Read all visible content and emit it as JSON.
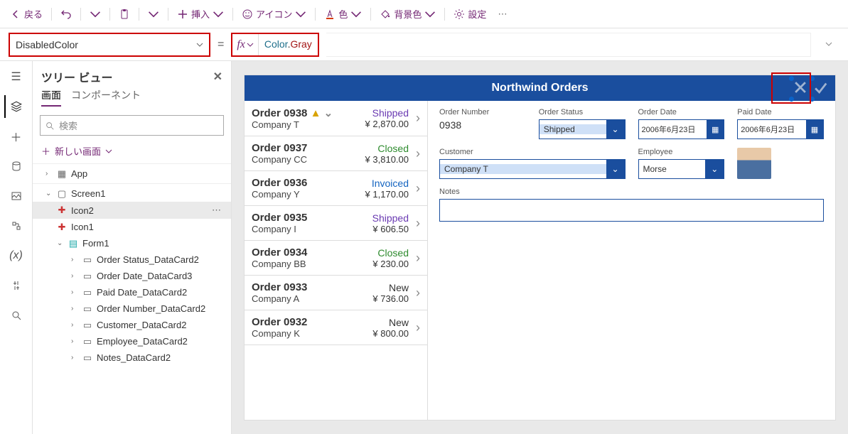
{
  "toolbar": {
    "back": "戻る",
    "insert": "挿入",
    "icon": "アイコン",
    "color": "色",
    "bg": "背景色",
    "settings": "設定"
  },
  "property": {
    "name": "DisabledColor"
  },
  "formula": {
    "part1": "Color",
    "part2": ".",
    "part3": "Gray"
  },
  "tree": {
    "title": "ツリー ビュー",
    "tab_screen": "画面",
    "tab_comp": "コンポーネント",
    "search_ph": "検索",
    "new_screen": "新しい画面",
    "nodes": {
      "app": "App",
      "screen1": "Screen1",
      "icon2": "Icon2",
      "icon1": "Icon1",
      "form1": "Form1",
      "dc_status": "Order Status_DataCard2",
      "dc_orderdate": "Order Date_DataCard3",
      "dc_paid": "Paid Date_DataCard2",
      "dc_num": "Order Number_DataCard2",
      "dc_cust": "Customer_DataCard2",
      "dc_emp": "Employee_DataCard2",
      "dc_notes": "Notes_DataCard2"
    }
  },
  "app": {
    "title": "Northwind Orders",
    "orders": [
      {
        "title": "Order 0938",
        "company": "Company T",
        "status": "Shipped",
        "price": "¥ 2,870.00",
        "warn": true
      },
      {
        "title": "Order 0937",
        "company": "Company CC",
        "status": "Closed",
        "price": "¥ 3,810.00"
      },
      {
        "title": "Order 0936",
        "company": "Company Y",
        "status": "Invoiced",
        "price": "¥ 1,170.00"
      },
      {
        "title": "Order 0935",
        "company": "Company I",
        "status": "Shipped",
        "price": "¥ 606.50"
      },
      {
        "title": "Order 0934",
        "company": "Company BB",
        "status": "Closed",
        "price": "¥ 230.00"
      },
      {
        "title": "Order 0933",
        "company": "Company A",
        "status": "New",
        "price": "¥ 736.00"
      },
      {
        "title": "Order 0932",
        "company": "Company K",
        "status": "New",
        "price": "¥ 800.00"
      }
    ],
    "form": {
      "ordernum_l": "Order Number",
      "ordernum_v": "0938",
      "status_l": "Order Status",
      "status_v": "Shipped",
      "orderdate_l": "Order Date",
      "orderdate_v": "2006年6月23日",
      "paiddate_l": "Paid Date",
      "paiddate_v": "2006年6月23日",
      "customer_l": "Customer",
      "customer_v": "Company T",
      "employee_l": "Employee",
      "employee_v": "Morse",
      "notes_l": "Notes"
    }
  }
}
